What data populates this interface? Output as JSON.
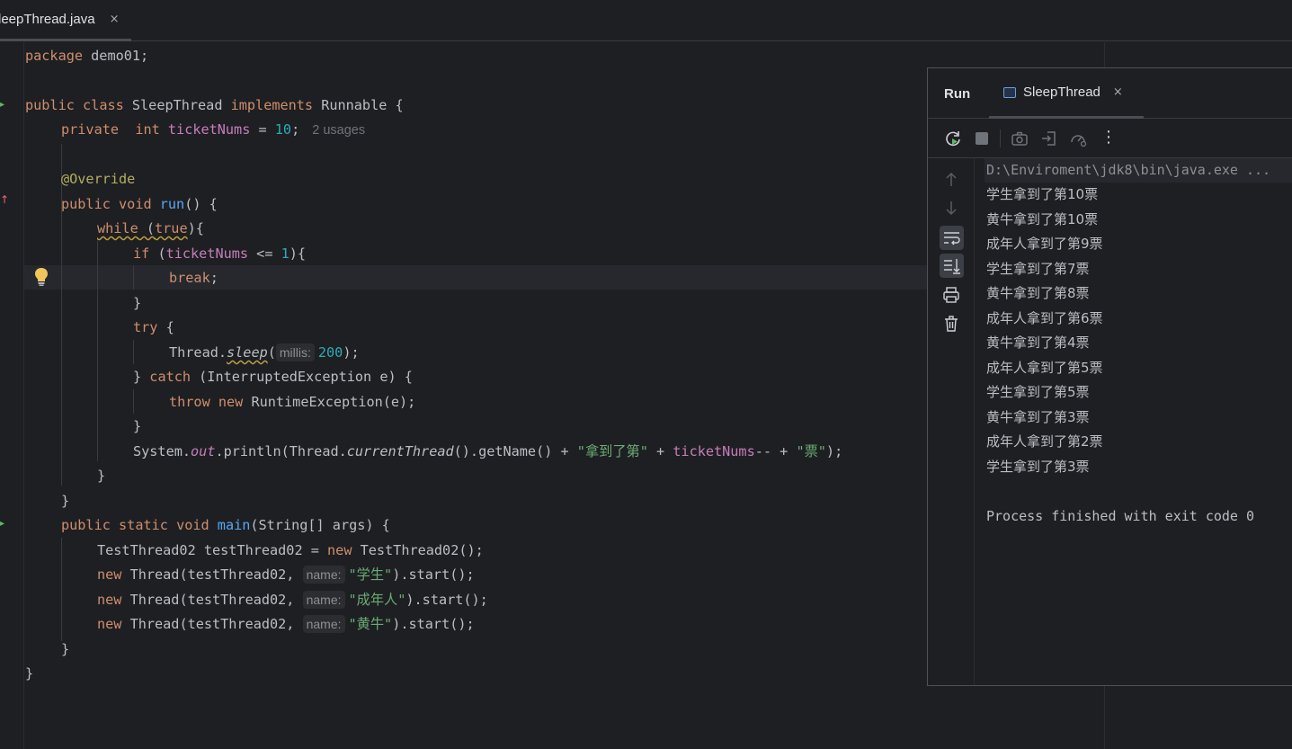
{
  "editor_tab": {
    "label": "SleepThread.java",
    "close": "×"
  },
  "code": {
    "l1": [
      "package",
      " demo01;"
    ],
    "l3": [
      "public",
      " ",
      "class",
      " SleepThread ",
      "implements",
      " Runnable {"
    ],
    "l4": [
      "private",
      "  ",
      "int",
      " ",
      "ticketNums",
      " = ",
      "10",
      ";",
      "2 usages"
    ],
    "l6": "@Override",
    "l7": [
      "public",
      " ",
      "void",
      " ",
      "run",
      "() {"
    ],
    "l8": [
      "while",
      " (",
      "true",
      "){"
    ],
    "l9": [
      "if",
      " (",
      "ticketNums",
      " <= ",
      "1",
      "){"
    ],
    "l10": [
      "break",
      ";"
    ],
    "l11": "}",
    "l12": [
      "try",
      " {"
    ],
    "l13": [
      "Thread.",
      "sleep",
      "(",
      "millis:",
      "200",
      ");"
    ],
    "l14": [
      "} ",
      "catch",
      " (InterruptedException e) {"
    ],
    "l15": [
      "throw",
      " ",
      "new",
      " RuntimeException(e);"
    ],
    "l16": "}",
    "l17": [
      "System.",
      "out",
      ".println(Thread.",
      "currentThread",
      "().getName() + ",
      "\"拿到了第\"",
      " + ",
      "ticketNums",
      "-- + ",
      "\"票\"",
      ");"
    ],
    "l18": "}",
    "l19": "}",
    "l20": [
      "public",
      " ",
      "static",
      " ",
      "void",
      " ",
      "main",
      "(String[] args) {"
    ],
    "l21": [
      "TestThread02 testThread02 = ",
      "new",
      " TestThread02();"
    ],
    "l22": [
      "new",
      " Thread(testThread02, ",
      "name:",
      "\"学生\"",
      ").start();"
    ],
    "l23": [
      "new",
      " Thread(testThread02, ",
      "name:",
      "\"成年人\"",
      ").start();"
    ],
    "l24": [
      "new",
      " Thread(testThread02, ",
      "name:",
      "\"黄牛\"",
      ").start();"
    ],
    "l25": "}",
    "l26": "}"
  },
  "run": {
    "title": "Run",
    "tab_label": "SleepThread",
    "tab_close": "×",
    "toolbar_icons": [
      "rerun-icon",
      "stop-icon",
      "camera-icon",
      "attach-icon",
      "profiler-icon",
      "more-icon"
    ],
    "more": "⋮",
    "console": {
      "cmd": "D:\\Enviroment\\jdk8\\bin\\java.exe ...",
      "lines": [
        "学生拿到了第10票",
        "黄牛拿到了第10票",
        "成年人拿到了第9票",
        "学生拿到了第7票",
        "黄牛拿到了第8票",
        "成年人拿到了第6票",
        "黄牛拿到了第4票",
        "成年人拿到了第5票",
        "学生拿到了第5票",
        "黄牛拿到了第3票",
        "成年人拿到了第2票",
        "学生拿到了第3票"
      ],
      "exit": "Process finished with exit code 0"
    }
  },
  "colors": {
    "background": "#1e1f22",
    "keyword": "#cf8e6d",
    "function": "#56a8f5",
    "field": "#c77dbb",
    "number": "#2aacb8",
    "string": "#6aab73",
    "annotation": "#b3ae60"
  }
}
